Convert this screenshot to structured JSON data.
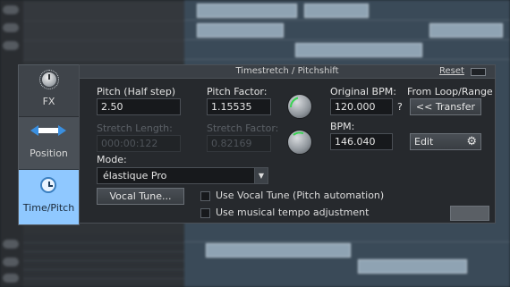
{
  "window": {
    "title": "Timestretch / Pitchshift",
    "reset_label": "Reset"
  },
  "tabs": [
    {
      "label": "FX",
      "icon": "knob-icon",
      "selected": false
    },
    {
      "label": "Position",
      "icon": "arrows-icon",
      "selected": false
    },
    {
      "label": "Time/Pitch",
      "icon": "clock-icon",
      "selected": true
    }
  ],
  "pitch_half_step": {
    "label": "Pitch (Half step)",
    "value": "2.50"
  },
  "pitch_factor": {
    "label": "Pitch Factor:",
    "value": "1.15535"
  },
  "stretch_length": {
    "label": "Stretch Length:",
    "value": "000:00:122",
    "enabled": false
  },
  "stretch_factor": {
    "label": "Stretch Factor:",
    "value": "0.82169",
    "enabled": false
  },
  "original_bpm": {
    "label": "Original BPM:",
    "value": "120.000",
    "help": "?"
  },
  "bpm": {
    "label": "BPM:",
    "value": "146.040"
  },
  "loop_range": {
    "label": "From Loop/Range",
    "transfer_button": "<< Transfer"
  },
  "edit_button": "Edit",
  "mode": {
    "label": "Mode:",
    "selected": "élastique Pro"
  },
  "vocal_tune_button": "Vocal Tune...",
  "checkboxes": [
    {
      "label": "Use Vocal Tune (Pitch automation)",
      "checked": false
    },
    {
      "label": "Use musical tempo adjustment",
      "checked": false
    }
  ],
  "colors": {
    "accent": "#8fc8ff",
    "panel_bg": "#26292d",
    "knob_marker": "#39d353"
  }
}
